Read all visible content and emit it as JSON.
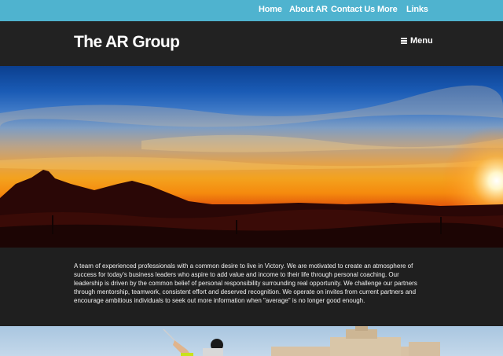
{
  "top_nav": {
    "items": [
      {
        "label": "Home"
      },
      {
        "label": "About AR"
      },
      {
        "label": "Contact Us"
      },
      {
        "label": "More"
      },
      {
        "label": "Links"
      }
    ]
  },
  "header": {
    "brand": "The AR Group",
    "menu_label": "Menu",
    "menu_icon": "hamburger-icon"
  },
  "hero": {
    "image": "desert-sunset-mountain-silhouette"
  },
  "about": {
    "text": "A team of experienced professionals with a common desire to live in Victory.  We are motivated to create an atmosphere of success for today's business leaders who aspire to add value and income to their life through personal coaching. Our leadership is driven by the common belief of personal responsibility surrounding real opportunity. We challenge our partners through mentorship, teamwork, consistent effort and deserved recognition. We operate on invites from current partners and encourage ambitious individuals to seek out more information when \"average\" is no longer good enough."
  },
  "photo": {
    "image": "golfer-and-resort-building"
  },
  "colors": {
    "nav_bg": "#4fb3cf",
    "header_bg": "#222222",
    "section_bg": "#1f1f1f"
  }
}
